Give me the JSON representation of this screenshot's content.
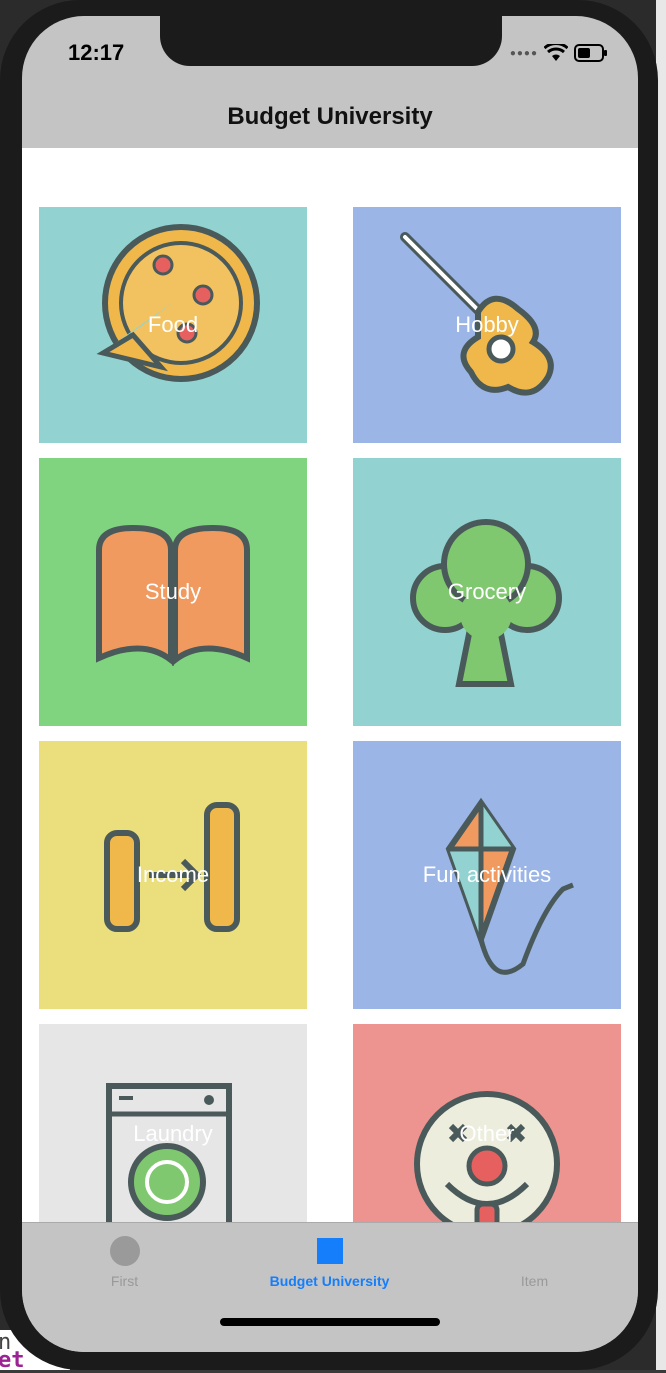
{
  "status_bar": {
    "time": "12:17"
  },
  "nav": {
    "title": "Budget University"
  },
  "tiles": [
    {
      "label": "Food",
      "color": "#92d3d1",
      "icon": "pizza-icon"
    },
    {
      "label": "Hobby",
      "color": "#9bb5e6",
      "icon": "guitar-icon"
    },
    {
      "label": "Study",
      "color": "#80d47f",
      "icon": "book-icon"
    },
    {
      "label": "Grocery",
      "color": "#92d3d1",
      "icon": "broccoli-icon"
    },
    {
      "label": "Income",
      "color": "#eade7d",
      "icon": "coins-icon"
    },
    {
      "label": "Fun activities",
      "color": "#9bb5e6",
      "icon": "kite-icon"
    },
    {
      "label": "Laundry",
      "color": "#e6e6e6",
      "icon": "washing-machine-icon"
    },
    {
      "label": "Other",
      "color": "#ee9490",
      "icon": "clown-icon"
    }
  ],
  "tab_bar": {
    "tabs": [
      {
        "label": "First",
        "selected": false
      },
      {
        "label": "Budget University",
        "selected": true
      },
      {
        "label": "Item",
        "selected": false
      }
    ],
    "selected_color": "#147efb",
    "unselected_color": "#999999"
  },
  "ide": {
    "line1": "n",
    "line2": "et"
  }
}
